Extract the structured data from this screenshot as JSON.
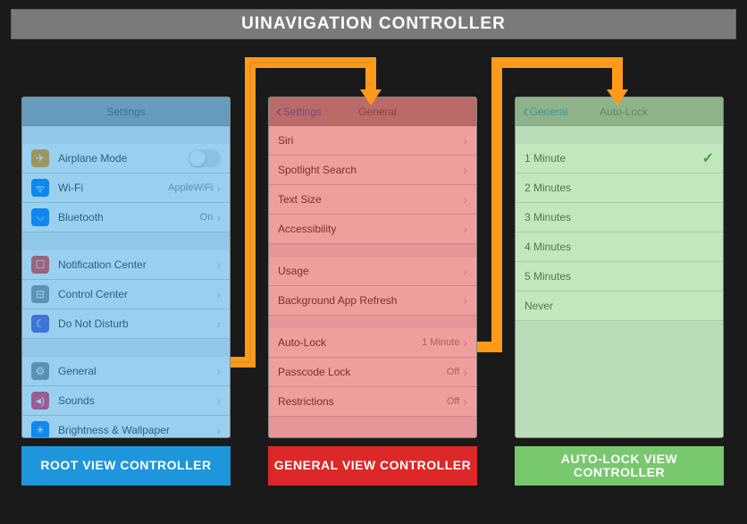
{
  "header": "UINAVIGATION CONTROLLER",
  "root": {
    "title": "Settings",
    "g1": [
      {
        "icon": "✈",
        "bg": "#ff9500",
        "label": "Airplane Mode",
        "toggle": true
      },
      {
        "icon": "ᯤ",
        "bg": "#007aff",
        "label": "Wi-Fi",
        "value": "AppleWiFi",
        "chev": true
      },
      {
        "icon": "⌵",
        "bg": "#007aff",
        "label": "Bluetooth",
        "value": "On",
        "chev": true
      }
    ],
    "g2": [
      {
        "icon": "☐",
        "bg": "#ff3b30",
        "label": "Notification Center",
        "chev": true
      },
      {
        "icon": "⊟",
        "bg": "#8e8e93",
        "label": "Control Center",
        "chev": true
      },
      {
        "icon": "☾",
        "bg": "#5856d6",
        "label": "Do Not Disturb",
        "chev": true
      }
    ],
    "g3": [
      {
        "icon": "⚙",
        "bg": "#8e8e93",
        "label": "General",
        "chev": true
      },
      {
        "icon": "◂)",
        "bg": "#ff2d55",
        "label": "Sounds",
        "chev": true
      },
      {
        "icon": "☀",
        "bg": "#007aff",
        "label": "Brightness & Wallpaper",
        "chev": true
      }
    ]
  },
  "general": {
    "back": "Settings",
    "title": "General",
    "g1": [
      {
        "label": "Siri",
        "chev": true
      },
      {
        "label": "Spotlight Search",
        "chev": true
      },
      {
        "label": "Text Size",
        "chev": true
      },
      {
        "label": "Accessibility",
        "chev": true
      }
    ],
    "g2": [
      {
        "label": "Usage",
        "chev": true
      },
      {
        "label": "Background App Refresh",
        "chev": true
      }
    ],
    "g3": [
      {
        "label": "Auto-Lock",
        "value": "1 Minute",
        "chev": true
      },
      {
        "label": "Passcode Lock",
        "value": "Off",
        "chev": true
      },
      {
        "label": "Restrictions",
        "value": "Off",
        "chev": true
      }
    ]
  },
  "autolock": {
    "back": "General",
    "title": "Auto-Lock",
    "items": [
      {
        "label": "1 Minute",
        "check": true
      },
      {
        "label": "2 Minutes"
      },
      {
        "label": "3 Minutes"
      },
      {
        "label": "4 Minutes"
      },
      {
        "label": "5 Minutes"
      },
      {
        "label": "Never"
      }
    ]
  },
  "badges": {
    "root": "ROOT VIEW CONTROLLER",
    "general": "GENERAL VIEW CONTROLLER",
    "autolock": "AUTO-LOCK VIEW CONTROLLER"
  }
}
